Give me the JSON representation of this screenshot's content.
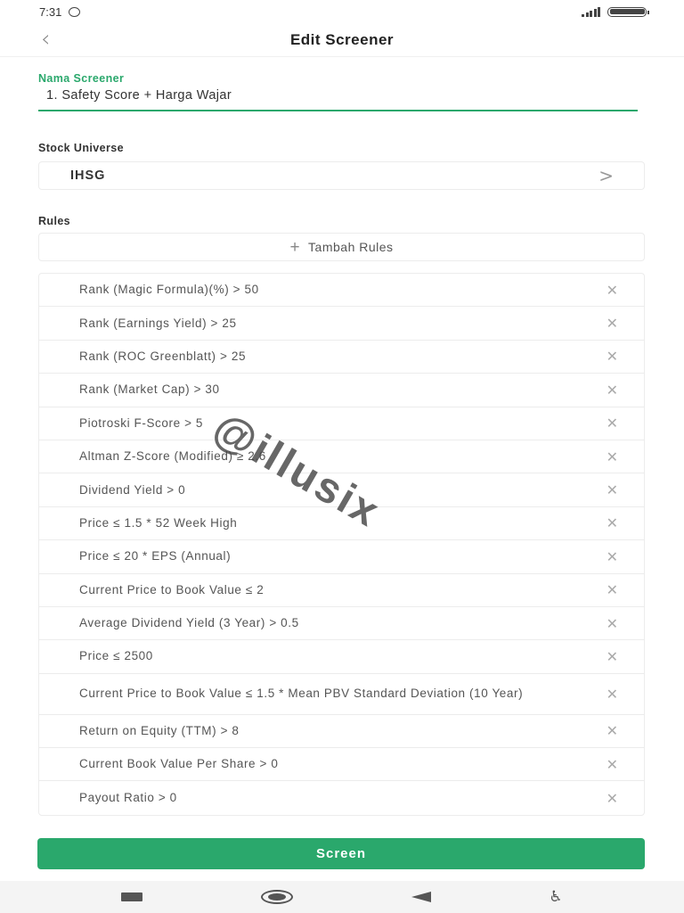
{
  "status_bar": {
    "time": "7:31",
    "icons": [
      "alarm-icon",
      "signal-icon",
      "battery-icon"
    ]
  },
  "header": {
    "back_icon": "‹",
    "title": "Edit Screener"
  },
  "form": {
    "name_label": "Nama Screener",
    "name_value": "1. Safety Score + Harga Wajar",
    "universe_label": "Stock Universe",
    "universe_value": "IHSG",
    "universe_chevron": ">"
  },
  "rules": {
    "label": "Rules",
    "add_icon": "+",
    "add_label": "Tambah Rules",
    "remove_icon": "✕",
    "items": [
      "Rank (Magic Formula)(%) > 50",
      "Rank (Earnings Yield) > 25",
      "Rank (ROC Greenblatt) > 25",
      "Rank (Market Cap) > 30",
      "Piotroski F-Score > 5",
      "Altman Z-Score (Modified) ≥ 2.6",
      "Dividend Yield > 0",
      "Price ≤ 1.5 * 52 Week High",
      "Price ≤ 20 * EPS (Annual)",
      "Current Price to Book Value ≤ 2",
      "Average Dividend Yield (3 Year) > 0.5",
      "Price ≤ 2500",
      "Current Price to Book Value ≤ 1.5 * Mean PBV Standard Deviation (10 Year)",
      "Return on Equity (TTM) > 8",
      "Current Book Value Per Share > 0",
      "Payout Ratio > 0"
    ]
  },
  "actions": {
    "screen_label": "Screen"
  },
  "nav_bar": {
    "icons": [
      "recent-apps-icon",
      "home-icon",
      "back-icon",
      "accessibility-icon"
    ],
    "accessibility_glyph": "♿"
  },
  "watermark": "@illusix",
  "colors": {
    "accent": "#2aa86c",
    "border": "#ececec",
    "text": "#555555"
  }
}
